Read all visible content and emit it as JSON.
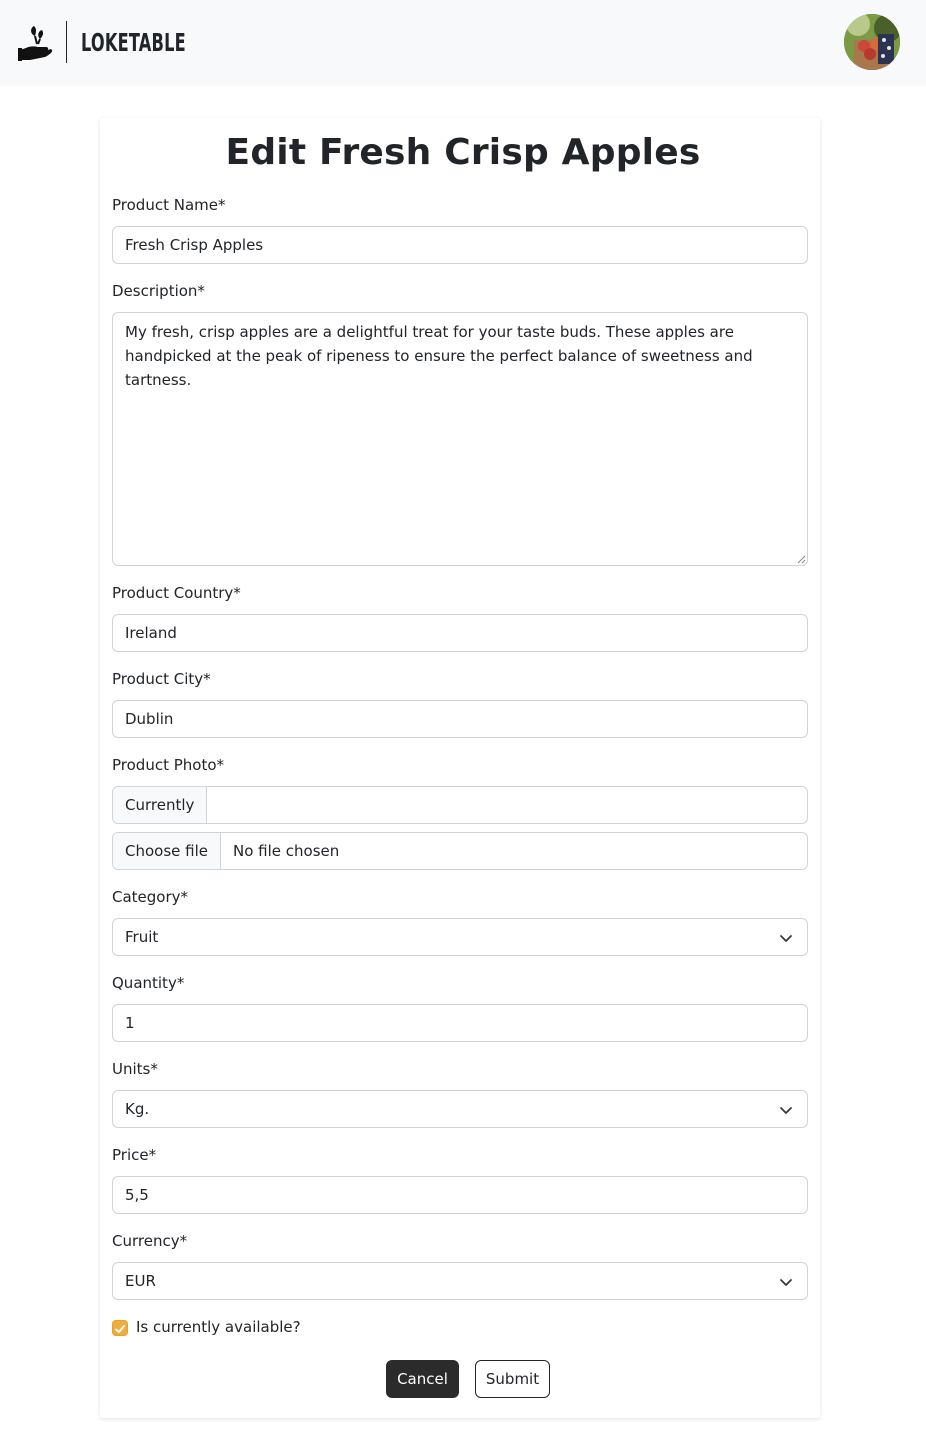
{
  "header": {
    "brand_name": "LOKETABLE",
    "logo_icon": "hand-plant-icon",
    "avatar_icon": "user-avatar"
  },
  "page": {
    "title": "Edit Fresh Crisp Apples"
  },
  "form": {
    "product_name_label": "Product Name*",
    "product_name_value": "Fresh Crisp Apples",
    "description_label": "Description*",
    "description_value": "My fresh, crisp apples are a delightful treat for your taste buds. These apples are handpicked at the peak of ripeness to ensure the perfect balance of sweetness and tartness.",
    "country_label": "Product Country*",
    "country_value": "Ireland",
    "city_label": "Product City*",
    "city_value": "Dublin",
    "photo_label": "Product Photo*",
    "photo_currently_label": "Currently",
    "photo_currently_value": "",
    "photo_choose_label": "Choose file",
    "photo_choose_value": "No file chosen",
    "category_label": "Category*",
    "category_value": "Fruit",
    "quantity_label": "Quantity*",
    "quantity_value": "1",
    "units_label": "Units*",
    "units_value": "Kg.",
    "price_label": "Price*",
    "price_value": "5,5",
    "currency_label": "Currency*",
    "currency_value": "EUR",
    "available_label": "Is currently available?",
    "available_checked": true,
    "cancel_label": "Cancel",
    "submit_label": "Submit"
  },
  "colors": {
    "navbar_bg": "#f8f9fa",
    "checkbox_accent": "#f0ad3d",
    "cancel_bg": "#2b2b2b"
  }
}
